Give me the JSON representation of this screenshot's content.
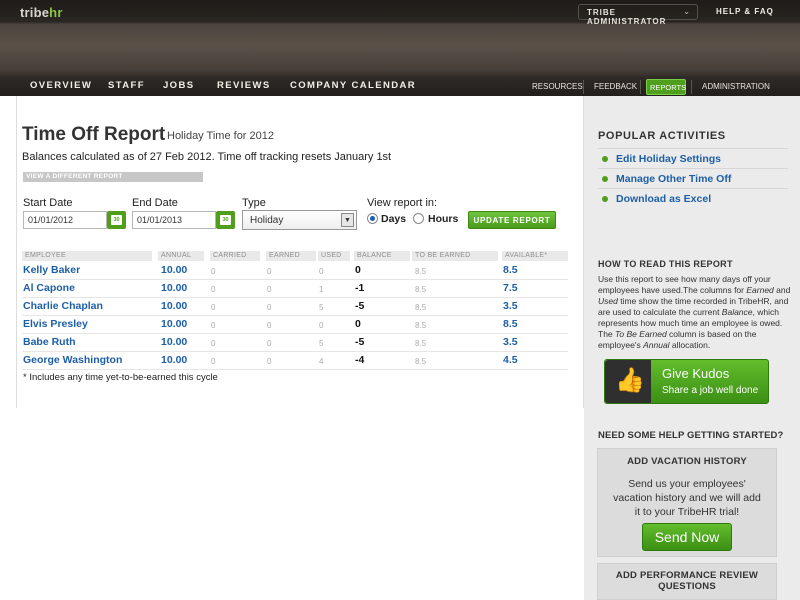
{
  "app": {
    "logo_main": "tribe",
    "logo_accent": "hr"
  },
  "header": {
    "account_menu": "TRIBE ADMINISTRATOR",
    "help_link": "HELP & FAQ"
  },
  "nav": {
    "main": [
      "OVERVIEW",
      "STAFF",
      "JOBS",
      "REVIEWS",
      "COMPANY CALENDAR"
    ],
    "secondary": [
      "RESOURCES",
      "FEEDBACK",
      "REPORTS",
      "ADMINISTRATION"
    ],
    "active": "REPORTS"
  },
  "report": {
    "title": "Time Off Report",
    "subtitle": "Holiday Time for 2012",
    "balances_note": "Balances calculated as of 27 Feb 2012. Time off tracking resets January 1st",
    "view_different": "VIEW A DIFFERENT REPORT",
    "start_label": "Start Date",
    "start_value": "01/01/2012",
    "end_label": "End Date",
    "end_value": "01/01/2013",
    "type_label": "Type",
    "type_value": "Holiday",
    "view_in_label": "View report in:",
    "unit_days": "Days",
    "unit_hours": "Hours",
    "unit_selected": "Days",
    "update_button": "UPDATE REPORT"
  },
  "table": {
    "columns": [
      "EMPLOYEE",
      "ANNUAL",
      "CARRIED",
      "EARNED",
      "USED",
      "BALANCE",
      "TO BE EARNED",
      "AVAILABLE*"
    ],
    "rows": [
      {
        "employee": "Kelly Baker",
        "annual": "10.00",
        "carried": "0",
        "earned": "0",
        "used": "0",
        "balance": "0",
        "to_be_earned": "8.5",
        "available": "8.5"
      },
      {
        "employee": "Al Capone",
        "annual": "10.00",
        "carried": "0",
        "earned": "0",
        "used": "1",
        "balance": "-1",
        "to_be_earned": "8.5",
        "available": "7.5"
      },
      {
        "employee": "Charlie Chaplan",
        "annual": "10.00",
        "carried": "0",
        "earned": "0",
        "used": "5",
        "balance": "-5",
        "to_be_earned": "8.5",
        "available": "3.5"
      },
      {
        "employee": "Elvis Presley",
        "annual": "10.00",
        "carried": "0",
        "earned": "0",
        "used": "0",
        "balance": "0",
        "to_be_earned": "8.5",
        "available": "8.5"
      },
      {
        "employee": "Babe Ruth",
        "annual": "10.00",
        "carried": "0",
        "earned": "0",
        "used": "5",
        "balance": "-5",
        "to_be_earned": "8.5",
        "available": "3.5"
      },
      {
        "employee": "George Washington",
        "annual": "10.00",
        "carried": "0",
        "earned": "0",
        "used": "4",
        "balance": "-4",
        "to_be_earned": "8.5",
        "available": "4.5"
      }
    ],
    "footnote": "* Includes any time yet-to-be-earned this cycle"
  },
  "sidebar": {
    "popular_title": "POPULAR ACTIVITIES",
    "popular_items": [
      "Edit Holiday Settings",
      "Manage Other Time Off",
      "Download as Excel"
    ],
    "howto_title": "HOW TO READ THIS REPORT",
    "howto_parts": [
      "Use this report to see how many days off your employees have used.The columns for ",
      "Earned",
      " and ",
      "Used",
      " time show the time recorded in TribeHR, and are used to calculate the current ",
      "Balance",
      ", which represents how much time an employee is owed. The ",
      "To Be Earned",
      " column is based on the employee's ",
      "Annual",
      " allocation."
    ],
    "kudos_title": "Give Kudos",
    "kudos_sub": "Share a job well done",
    "help_title": "NEED SOME HELP GETTING STARTED?",
    "card1_title": "ADD VACATION HISTORY",
    "card1_body": "Send us your employees' vacation history and we will add it to your TribeHR trial!",
    "card1_button": "Send Now",
    "card2_title": "ADD PERFORMANCE REVIEW QUESTIONS"
  }
}
